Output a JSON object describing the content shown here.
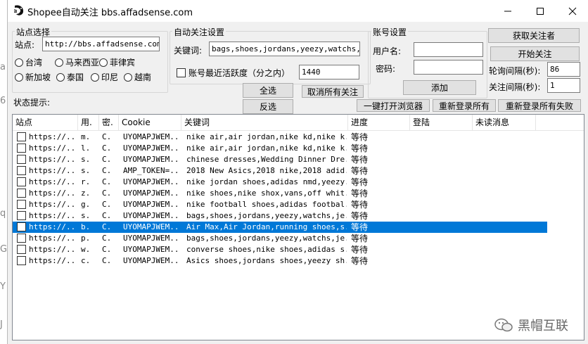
{
  "background_strip": [
    "a",
    "6",
    "q",
    "G",
    "Y",
    "J"
  ],
  "window": {
    "title": "Shopee自动关注  bbs.affadsense.com",
    "minimize": "—",
    "maximize": "☐",
    "close": "✕"
  },
  "site_group": {
    "label": "站点选择",
    "site_label": "站点:",
    "site_value": "http://bbs.affadsense.com",
    "radios": [
      "台湾",
      "马来西亚",
      "菲律宾",
      "新加坡",
      "泰国",
      "印尼",
      "越南"
    ]
  },
  "auto_group": {
    "label": "自动关注设置",
    "keyword_label": "关键词:",
    "keyword_value": "bags,shoes,jordans,yeezy,watchs,jer",
    "activity_label": "账号最近活跃度（分之内）",
    "activity_value": "1440",
    "select_all": "全选",
    "cancel_all": "取消所有关注",
    "invert": "反选"
  },
  "account_group": {
    "label": "账号设置",
    "username_label": "用户名:",
    "username_value": "",
    "password_label": "密码:",
    "password_value": "",
    "add_button": "添加"
  },
  "right_panel": {
    "get_followers": "获取关注者",
    "start_follow": "开始关注",
    "poll_label": "轮询间隔(秒):",
    "poll_value": "86",
    "follow_label": "关注间隔(秒):",
    "follow_value": "1"
  },
  "status": {
    "label": "状态提示:",
    "open_browser": "一键打开浏览器",
    "relogin_all": "重新登录所有",
    "relogin_failed": "重新登录所有失败"
  },
  "table": {
    "columns": [
      "站点",
      "用.",
      "密.",
      "Cookie",
      "关键词",
      "进度",
      "登陆",
      "未读消息"
    ],
    "rows": [
      {
        "site": "https://...",
        "user": "m.",
        "pwd": "C.",
        "cookie": "UYOMAPJWEM...",
        "keywords": "nike air,air jordan,nike kd,nike k...",
        "progress": "等待"
      },
      {
        "site": "https://...",
        "user": "l.",
        "pwd": "C.",
        "cookie": "UYOMAPJWEM...",
        "keywords": "nike air,air jordan,nike kd,nike k...",
        "progress": "等待"
      },
      {
        "site": "https://...",
        "user": "s.",
        "pwd": "C.",
        "cookie": "UYOMAPJWEM...",
        "keywords": "chinese dresses,Wedding Dinner Dre...",
        "progress": "等待"
      },
      {
        "site": "https://...",
        "user": "s.",
        "pwd": "C.",
        "cookie": "AMP_TOKEN=...",
        "keywords": "2018 New Asics,2018 nike,2018 adid...",
        "progress": "等待"
      },
      {
        "site": "https://...",
        "user": "r.",
        "pwd": "C.",
        "cookie": "UYOMAPJWEM...",
        "keywords": "nike jordan shoes,adidas nmd,yeezy...",
        "progress": "等待"
      },
      {
        "site": "https://...",
        "user": "z.",
        "pwd": "C.",
        "cookie": "UYOMAPJWEM...",
        "keywords": "nike shoes,nike shox,vans,off whit...",
        "progress": "等待"
      },
      {
        "site": "https://...",
        "user": "g.",
        "pwd": "C.",
        "cookie": "UYOMAPJWEM...",
        "keywords": "nike football shoes,adidas footbal...",
        "progress": "等待"
      },
      {
        "site": "https://...",
        "user": "s.",
        "pwd": "C.",
        "cookie": "UYOMAPJWEM...",
        "keywords": "bags,shoes,jordans,yeezy,watchs,je...",
        "progress": "等待"
      },
      {
        "site": "https://...",
        "user": "b.",
        "pwd": "C.",
        "cookie": "UYOMAPJWEM...",
        "keywords": "Air Max,Air Jordan,running shoes,s...",
        "progress": "等待",
        "selected": true
      },
      {
        "site": "https://...",
        "user": "p.",
        "pwd": "C.",
        "cookie": "UYOMAPJWEM...",
        "keywords": "bags,shoes,jordans,yeezy,watchs,je...",
        "progress": "等待"
      },
      {
        "site": "https://...",
        "user": "w.",
        "pwd": "C.",
        "cookie": "UYOMAPJWEM...",
        "keywords": "converse shoes,nike shoes,adidas s...",
        "progress": "等待"
      },
      {
        "site": "https://...",
        "user": "c.",
        "pwd": "C.",
        "cookie": "UYOMAPJWEM...",
        "keywords": "Asics shoes,jordans shoes,yeezy sh...",
        "progress": "等待"
      }
    ]
  },
  "watermark": "黑帽互联",
  "colors": {
    "selection": "#0078d7",
    "window_bg": "#f0f0f0",
    "button_bg": "#e1e1e1"
  }
}
